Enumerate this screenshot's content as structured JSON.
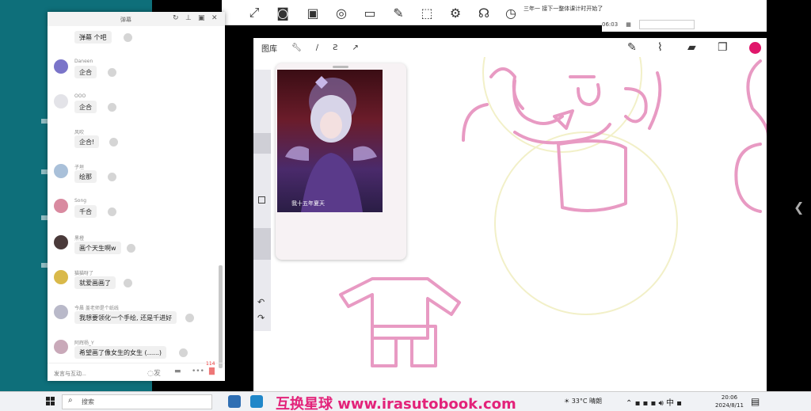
{
  "chat": {
    "title": "弹幕",
    "input_placeholder": "发言与互动...",
    "send_label": "发",
    "gift_count": "114",
    "messages": [
      {
        "user": "",
        "text": "弹幕 个吧",
        "avatar_color": "#c9c9c9"
      },
      {
        "user": "Daneen",
        "text": "企合",
        "avatar_color": "#7a74c9"
      },
      {
        "user": "OOO",
        "text": "企合",
        "avatar_color": "#e3e3e8"
      },
      {
        "user": "风吹",
        "text": "企合!",
        "avatar_color": "#3a3a4a"
      },
      {
        "user": "子垣",
        "text": "绘那",
        "avatar_color": "#a9c0d9"
      },
      {
        "user": "Song",
        "text": "千合",
        "avatar_color": "#d98aa0"
      },
      {
        "user": "黑橙",
        "text": "画个天生啊w",
        "avatar_color": "#4a3a3a"
      },
      {
        "user": "猫猫呀了",
        "text": "就爱画画了",
        "avatar_color": "#d9b94a"
      },
      {
        "user": "今晨 盖老师是个纸线",
        "text": "我想要领化一个手绘, 还是千进好",
        "avatar_color": "#b9b9c9"
      },
      {
        "user": "阿辉杨_Y",
        "text": "希望画了像女生的女生 (......)",
        "avatar_color": "#c9a9b9"
      }
    ]
  },
  "drawing_app": {
    "gallery_label": "图库",
    "ref_caption": "我十五年夏天",
    "brush_color": "#e0166b"
  },
  "meeting_strip": {
    "title": "三年一 接下一整体课计时开始了",
    "time": "06:03"
  },
  "taskbar": {
    "search_placeholder": "搜索",
    "watermark": "互换星球 www.irasutobook.com",
    "weather": "33°C 晴朗",
    "ime": "中",
    "time": "20:06",
    "date": "2024/8/11"
  }
}
